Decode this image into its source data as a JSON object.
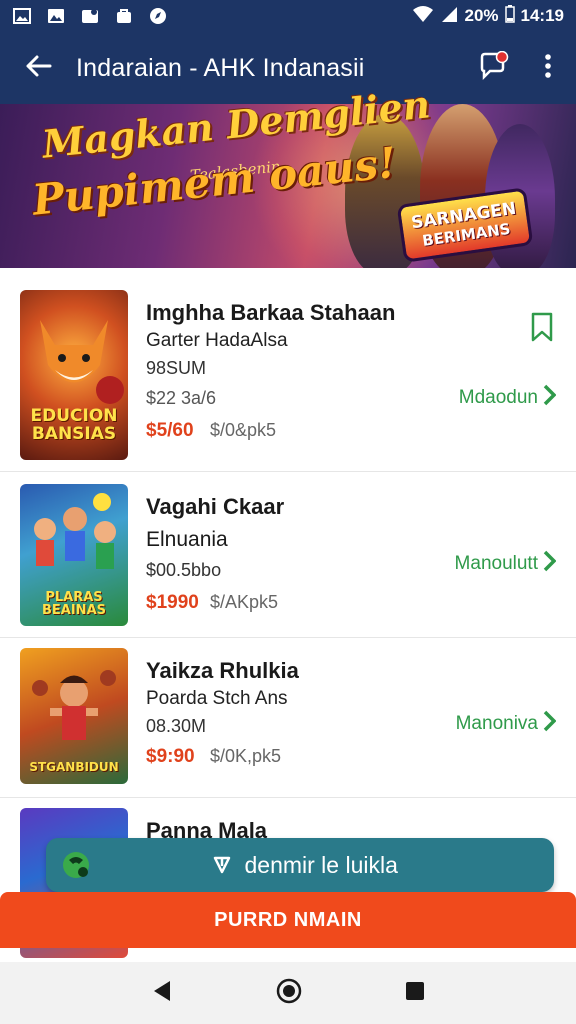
{
  "status_bar": {
    "battery": "20%",
    "time": "14:19",
    "icons": [
      "image-icon",
      "gallery-icon",
      "notification-icon",
      "bag-icon",
      "compass-icon",
      "wifi-icon",
      "signal-icon",
      "battery-icon"
    ]
  },
  "app_bar": {
    "title": "Indaraian - AHK Indanasii",
    "back_icon": "arrow-left-icon",
    "chat_icon": "chat-icon",
    "more_icon": "more-vertical-icon"
  },
  "banner": {
    "line1": "Magkan Demglien",
    "sub": "Tealasbenin",
    "line2": "Pupimem oaus!",
    "badge_line1": "SARNAGEN",
    "badge_line2": "BERIMANS"
  },
  "games": [
    {
      "title": "Imghha Barkaa Stahaan",
      "subtitle": "Garter HadaAlsa",
      "size": "98SUM",
      "old_price": "$22 3a/6",
      "sale_price": "$5/60",
      "strike_price": "$/0&pk5",
      "action": "Mdaodun",
      "thumb_label": "EDUCION BANSIAS",
      "bookmark_icon": "bookmark-icon"
    },
    {
      "title": "Vagahi Ckaar",
      "subtitle": "Elnuania",
      "size": "$00.5bbo",
      "sale_price": "$1990",
      "strike_price": "$/AKpk5",
      "action": "Manoulutt",
      "thumb_label": "PLARAS BEAINAS"
    },
    {
      "title": "Yaikza Rhulkia",
      "subtitle": "Poarda Stch Ans",
      "size": "08.30M",
      "sale_price": "$9:90",
      "strike_price": "$/0K,pk5",
      "action": "Manoniva"
    },
    {
      "title": "Panna Mala"
    }
  ],
  "download_bar": {
    "label": "denmir le luikla",
    "icon": "download-icon"
  },
  "purchase_bar": {
    "label": "PURRD NMAIN"
  },
  "nav_bar": {
    "back": "back-triangle-icon",
    "home": "home-circle-icon",
    "recents": "recents-square-icon"
  },
  "colors": {
    "app_bar": "#1d3565",
    "accent_green": "#2f9a4a",
    "sale_red": "#e0421c",
    "download_bar": "#2a7a8a",
    "purchase_bar": "#f04a1c"
  }
}
